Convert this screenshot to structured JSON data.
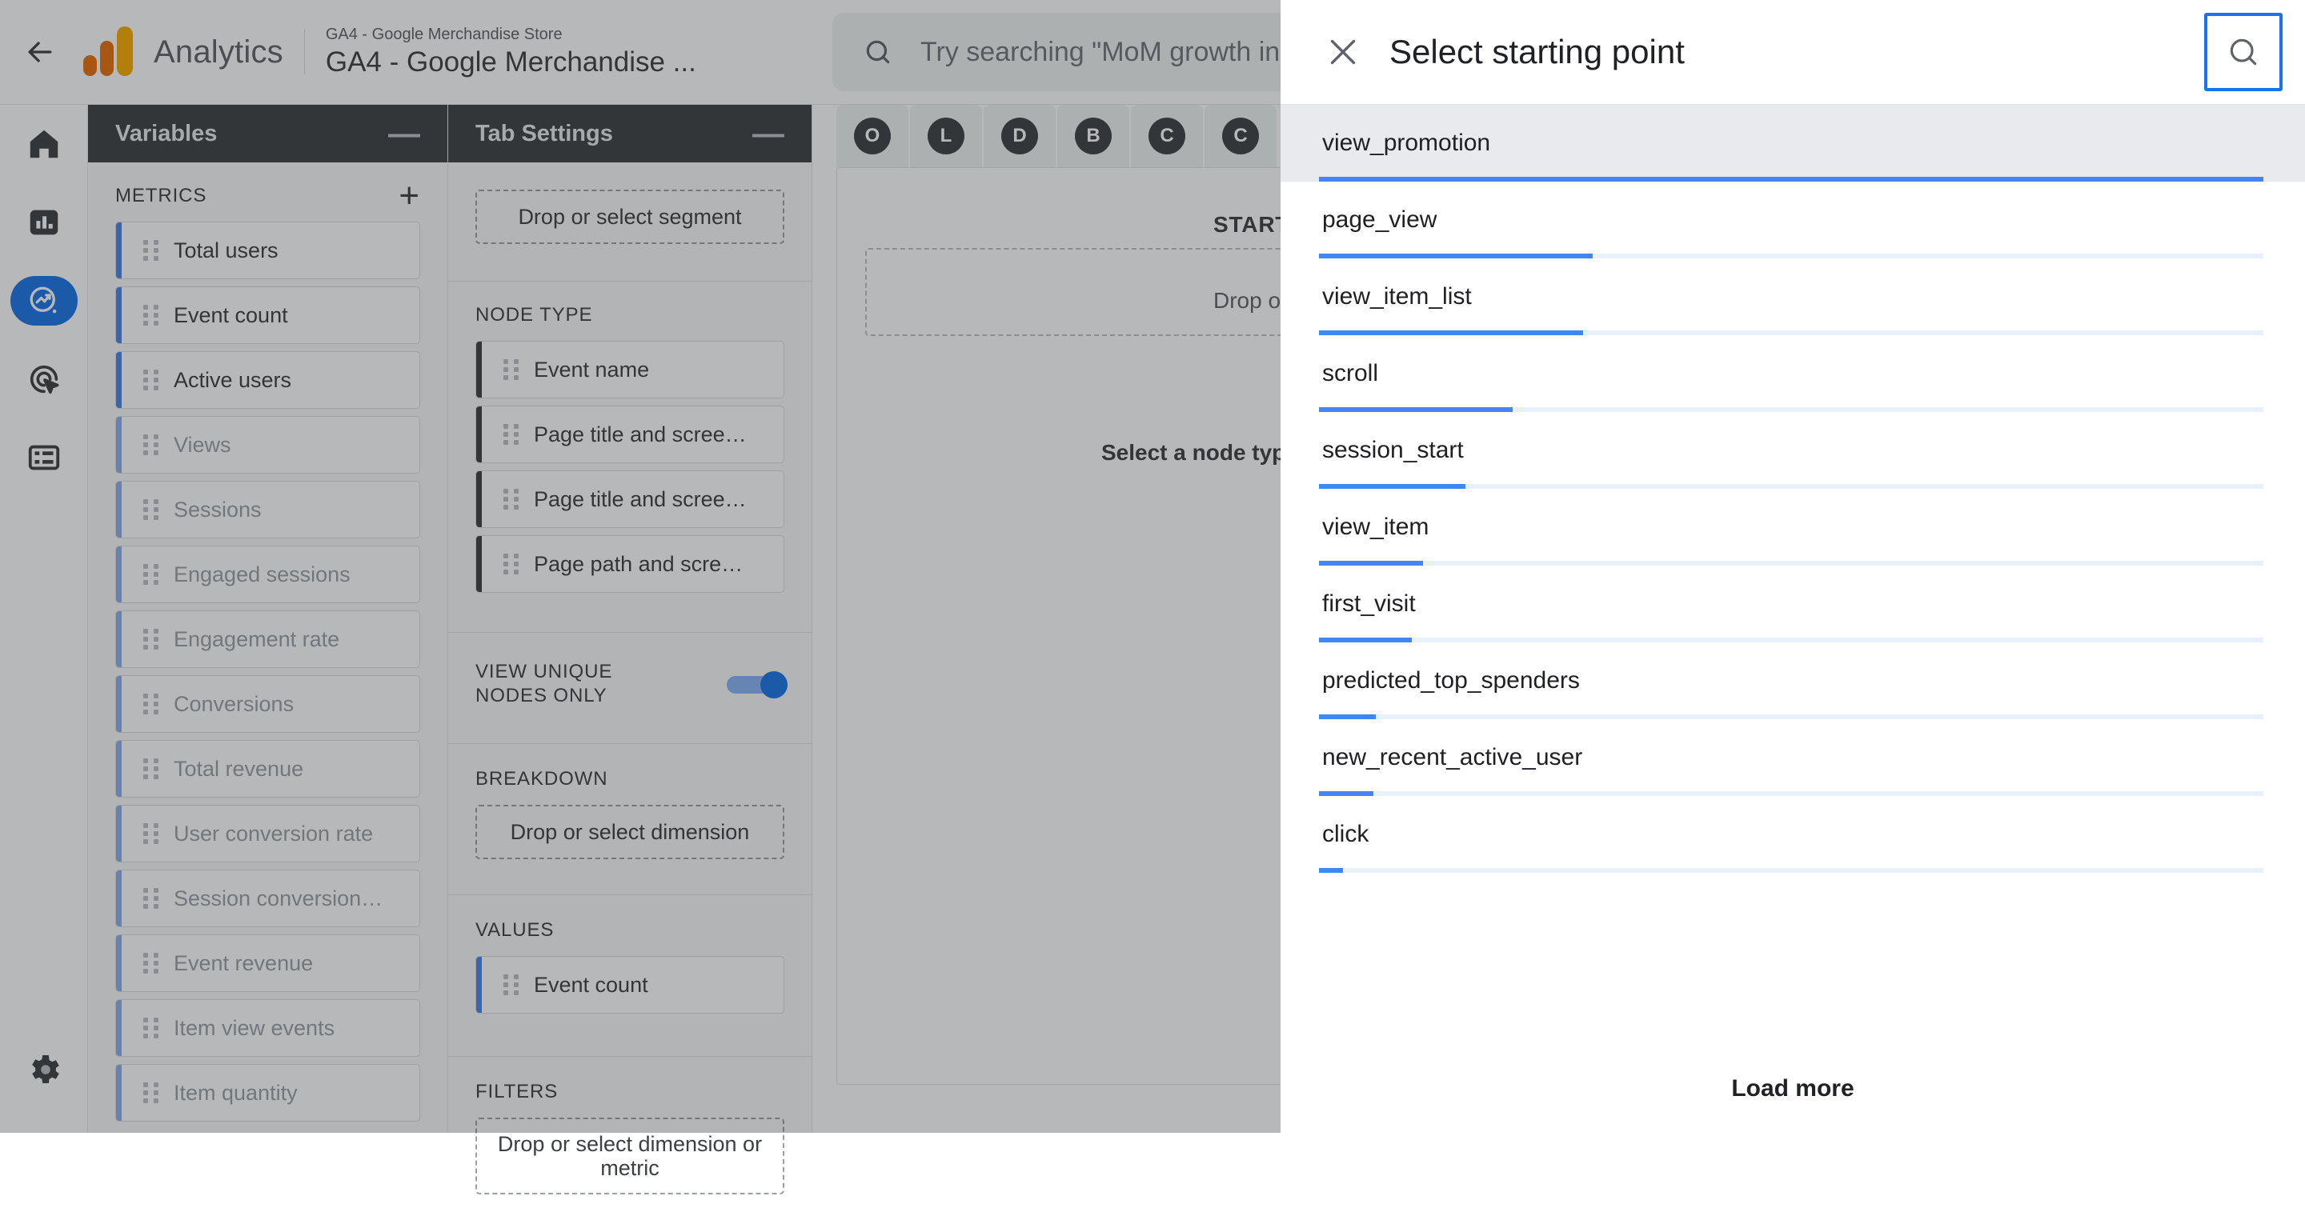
{
  "topbar": {
    "back_icon": "arrow-left-icon",
    "brand": "Analytics",
    "account_sub": "GA4 - Google Merchandise Store",
    "account_name": "GA4 - Google Merchandise ...",
    "search_placeholder": "Try searching \"MoM growth in users\"",
    "search_icon": "search-icon"
  },
  "rail": {
    "items": [
      {
        "name": "home",
        "icon": "home-icon",
        "selected": false
      },
      {
        "name": "reports",
        "icon": "bar-chart-icon",
        "selected": false
      },
      {
        "name": "explore",
        "icon": "explore-icon",
        "selected": true
      },
      {
        "name": "advertising",
        "icon": "advertising-target-icon",
        "selected": false
      },
      {
        "name": "library",
        "icon": "library-list-icon",
        "selected": false
      }
    ],
    "settings_icon": "gear-icon"
  },
  "variables": {
    "title": "Variables",
    "minimize": "—",
    "metrics_title": "METRICS",
    "add_icon": "+",
    "metrics": [
      {
        "label": "Total users",
        "active": true
      },
      {
        "label": "Event count",
        "active": true
      },
      {
        "label": "Active users",
        "active": true
      },
      {
        "label": "Views",
        "active": false
      },
      {
        "label": "Sessions",
        "active": false
      },
      {
        "label": "Engaged sessions",
        "active": false
      },
      {
        "label": "Engagement rate",
        "active": false
      },
      {
        "label": "Conversions",
        "active": false
      },
      {
        "label": "Total revenue",
        "active": false
      },
      {
        "label": "User conversion rate",
        "active": false
      },
      {
        "label": "Session conversion…",
        "active": false
      },
      {
        "label": "Event revenue",
        "active": false
      },
      {
        "label": "Item view events",
        "active": false
      },
      {
        "label": "Item quantity",
        "active": false
      }
    ]
  },
  "tab_settings": {
    "title": "Tab Settings",
    "minimize": "—",
    "segment_drop": "Drop or select segment",
    "node_type_title": "NODE TYPE",
    "node_types": [
      "Event name",
      "Page title and scree…",
      "Page title and scree…",
      "Page path and scre…"
    ],
    "unique_nodes_label": "VIEW UNIQUE NODES ONLY",
    "unique_nodes_on": true,
    "breakdown_title": "BREAKDOWN",
    "breakdown_drop": "Drop or select dimension",
    "values_title": "VALUES",
    "values": [
      "Event count"
    ],
    "filters_title": "FILTERS",
    "filters_drop": "Drop or select dimension or metric"
  },
  "canvas": {
    "tabs": [
      "O",
      "L",
      "D",
      "B",
      "C",
      "C"
    ],
    "starting_point_title": "STARTING POINT",
    "drop_node_text": "Drop or select node",
    "select_node_hint": "Select a node type"
  },
  "modal": {
    "close_icon": "close-icon",
    "title": "Select starting point",
    "search_icon": "search-icon",
    "load_more": "Load more",
    "events": [
      {
        "label": "view_promotion",
        "pct": 100.0,
        "hover": true
      },
      {
        "label": "page_view",
        "pct": 29.0,
        "hover": false
      },
      {
        "label": "view_item_list",
        "pct": 28.0,
        "hover": false
      },
      {
        "label": "scroll",
        "pct": 20.5,
        "hover": false
      },
      {
        "label": "session_start",
        "pct": 15.5,
        "hover": false
      },
      {
        "label": "view_item",
        "pct": 11.0,
        "hover": false
      },
      {
        "label": "first_visit",
        "pct": 9.8,
        "hover": false
      },
      {
        "label": "predicted_top_spenders",
        "pct": 6.0,
        "hover": false
      },
      {
        "label": "new_recent_active_user",
        "pct": 5.8,
        "hover": false
      },
      {
        "label": "click",
        "pct": 2.5,
        "hover": false
      }
    ]
  },
  "colors": {
    "accent": "#1a73e8",
    "bar_fill": "#4285f4",
    "bar_track": "#e8f0fe",
    "hover_bg": "#e8eaed",
    "panel_head_bg": "#3c4043"
  }
}
